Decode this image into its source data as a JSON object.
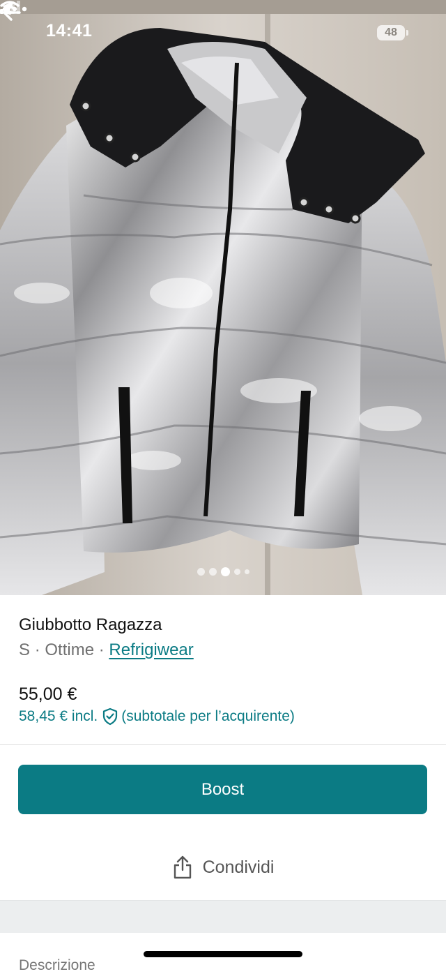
{
  "status_bar": {
    "time": "14:41",
    "battery": "48"
  },
  "gallery": {
    "dot_count": 5,
    "active_index": 2
  },
  "item": {
    "title": "Giubbotto Ragazza",
    "size": "S",
    "condition": "Ottime",
    "separator": "·",
    "brand": "Refrigiwear",
    "price": "55,00 €",
    "price_incl": "58,45 € incl.",
    "price_incl_note": "(subtotale per l’acquirente)"
  },
  "actions": {
    "boost_label": "Boost",
    "share_label": "Condividi"
  },
  "sections": {
    "description_label": "Descrizione"
  },
  "colors": {
    "accent": "#0b7b84",
    "jacket_silver": "#c9c9cb",
    "hood_black": "#1a1a1c"
  },
  "icons": {
    "back": "arrow-left-icon",
    "more": "more-horizontal-icon",
    "share": "share-icon",
    "shield": "shield-check-icon"
  }
}
